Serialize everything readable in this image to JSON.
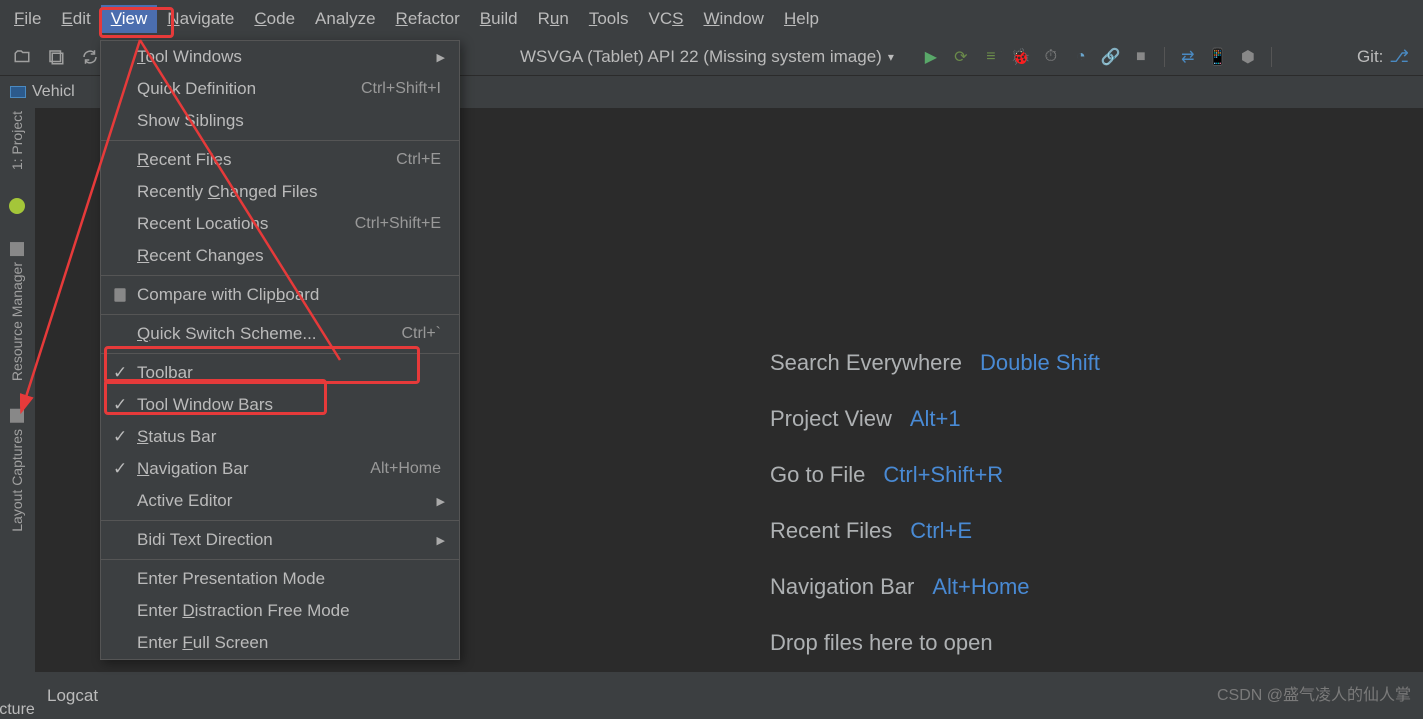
{
  "menubar": [
    "File",
    "Edit",
    "View",
    "Navigate",
    "Code",
    "Analyze",
    "Refactor",
    "Build",
    "Run",
    "Tools",
    "VCS",
    "Window",
    "Help"
  ],
  "menubar_underline": [
    "F",
    "E",
    "V",
    "N",
    "C",
    "",
    "R",
    "B",
    "u",
    "T",
    "S",
    "W",
    "H"
  ],
  "active_menu": "View",
  "device_selector": "WSVGA (Tablet) API 22 (Missing system image)",
  "git_label": "Git:",
  "tab_name": "Vehicl",
  "dropdown": [
    {
      "type": "item",
      "label": "Tool Windows",
      "submenu": true,
      "underline": "T"
    },
    {
      "type": "item",
      "label": "Quick Definition",
      "shortcut": "Ctrl+Shift+I"
    },
    {
      "type": "item",
      "label": "Show Siblings"
    },
    {
      "type": "sep"
    },
    {
      "type": "item",
      "label": "Recent Files",
      "shortcut": "Ctrl+E",
      "underline": "R"
    },
    {
      "type": "item",
      "label": "Recently Changed Files",
      "underline": "C"
    },
    {
      "type": "item",
      "label": "Recent Locations",
      "shortcut": "Ctrl+Shift+E"
    },
    {
      "type": "item",
      "label": "Recent Changes",
      "underline": "R"
    },
    {
      "type": "sep"
    },
    {
      "type": "item",
      "label": "Compare with Clipboard",
      "icon": "clipboard",
      "underline": "b"
    },
    {
      "type": "sep"
    },
    {
      "type": "item",
      "label": "Quick Switch Scheme...",
      "shortcut": "Ctrl+`",
      "underline": "Q"
    },
    {
      "type": "sep"
    },
    {
      "type": "item",
      "label": "Toolbar",
      "checked": true,
      "underline": "T"
    },
    {
      "type": "item",
      "label": "Tool Window Bars",
      "checked": true
    },
    {
      "type": "item",
      "label": "Status Bar",
      "checked": true,
      "underline": "S"
    },
    {
      "type": "item",
      "label": "Navigation Bar",
      "checked": true,
      "shortcut": "Alt+Home",
      "underline": "N"
    },
    {
      "type": "item",
      "label": "Active Editor",
      "submenu": true
    },
    {
      "type": "sep"
    },
    {
      "type": "item",
      "label": "Bidi Text Direction",
      "submenu": true
    },
    {
      "type": "sep"
    },
    {
      "type": "item",
      "label": "Enter Presentation Mode"
    },
    {
      "type": "item",
      "label": "Enter Distraction Free Mode",
      "underline": "D"
    },
    {
      "type": "item",
      "label": "Enter Full Screen",
      "underline": "F"
    }
  ],
  "leftbar": {
    "project": "1: Project",
    "resource": "Resource Manager",
    "layout": "Layout Captures",
    "structure_partial": "cture"
  },
  "welcome": [
    {
      "text": "Search Everywhere",
      "key": "Double Shift"
    },
    {
      "text": "Project View",
      "key": "Alt+1"
    },
    {
      "text": "Go to File",
      "key": "Ctrl+Shift+R"
    },
    {
      "text": "Recent Files",
      "key": "Ctrl+E"
    },
    {
      "text": "Navigation Bar",
      "key": "Alt+Home"
    },
    {
      "text": "Drop files here to open",
      "key": ""
    }
  ],
  "bottombar": {
    "logcat": "Logcat"
  },
  "watermark": "CSDN @盛气凌人的仙人掌",
  "colors": {
    "accent": "#4b6eaf",
    "highlight": "#e63a3a",
    "link": "#498ad4",
    "bg": "#3c3f41",
    "editor": "#2b2b2b"
  }
}
